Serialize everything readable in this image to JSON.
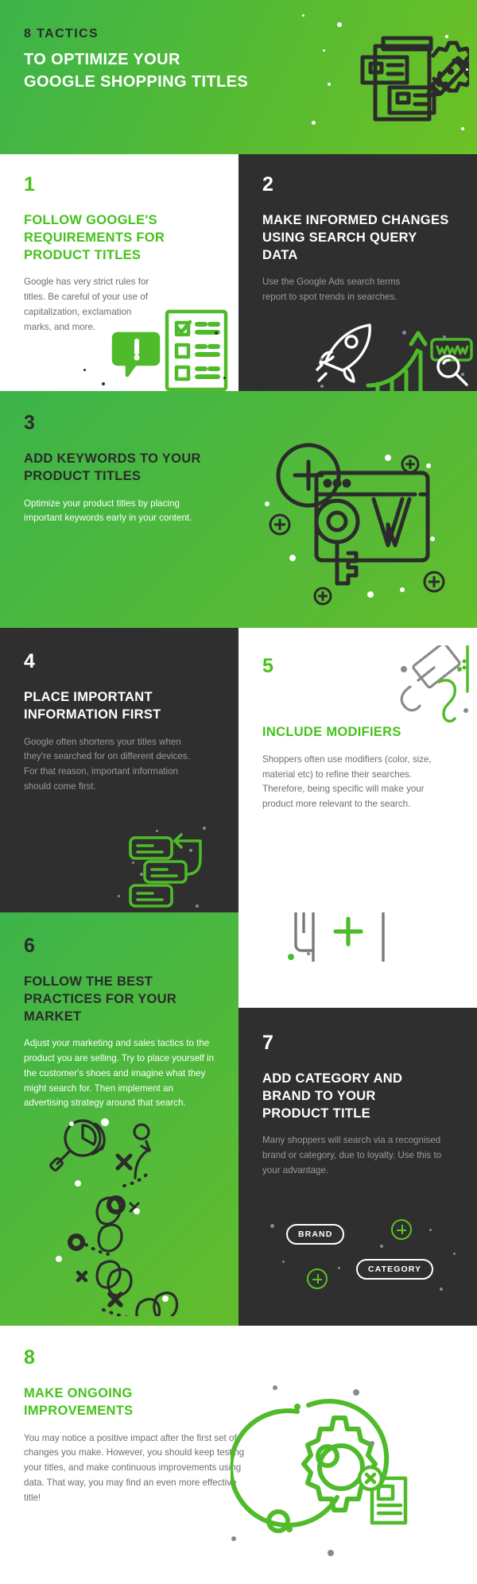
{
  "header": {
    "kicker": "8 TACTICS",
    "title_line1": "TO OPTIMIZE YOUR",
    "title_line2": "GOOGLE SHOPPING TITLES",
    "icon": "document-gear-pencil-icon"
  },
  "colors": {
    "green_bright": "#45c21c",
    "green_mid": "#57bb32",
    "green_dark": "#3cb44a",
    "dark": "#2f2f2f",
    "white": "#ffffff",
    "gray_text": "#6e6e6e",
    "muted_text": "#9a9a9a"
  },
  "sections": [
    {
      "number": "1",
      "heading": "FOLLOW GOOGLE'S REQUIREMENTS FOR PRODUCT TITLES",
      "body": "Google has very strict rules for titles. Be careful of your use of capitalization, exclamation marks, and more.",
      "theme": "white",
      "icon": "checklist-exclamation-icon"
    },
    {
      "number": "2",
      "heading": "MAKE INFORMED CHANGES USING SEARCH QUERY DATA",
      "body": "Use the Google Ads search terms report to spot trends in searches.",
      "theme": "dark",
      "icon": "rocket-growth-chart-www-search-icon"
    },
    {
      "number": "3",
      "heading": "ADD KEYWORDS TO YOUR PRODUCT TITLES",
      "body": "Optimize your product titles by placing important keywords early in your content.",
      "theme": "green",
      "icon": "browser-key-keyword-icon"
    },
    {
      "number": "4",
      "heading": "PLACE IMPORTANT INFORMATION FIRST",
      "body": "Google often shortens your titles when they're searched for on different devices. For that reason, important information should come first.",
      "theme": "dark",
      "icon": "reorder-list-arrow-icon"
    },
    {
      "number": "5",
      "heading": "INCLUDE MODIFIERS",
      "body": "Shoppers often use modifiers (color, size, material etc) to refine their searches. Therefore, being specific will make your product more relevant to the search.",
      "theme": "white",
      "icon": "paint-roller-icon",
      "icon2": "stacked-cards-plus-icon"
    },
    {
      "number": "6",
      "heading": "FOLLOW THE BEST PRACTICES FOR YOUR MARKET",
      "body": "Adjust your marketing and sales tactics to the product you are selling. Try to place yourself in the customer's shoes and imagine what they might search for. Then implement an advertising strategy around that search.",
      "theme": "green",
      "icon": "footprints-path-magnifier-icon"
    },
    {
      "number": "7",
      "heading": "ADD CATEGORY AND BRAND TO YOUR PRODUCT TITLE",
      "body": "Many shoppers will search via a recognised brand or category, due to loyalty. Use this to your advantage.",
      "theme": "dark",
      "icon": "tag-pills-icon",
      "pills": [
        "BRAND",
        "CATEGORY"
      ]
    },
    {
      "number": "8",
      "heading": "MAKE ONGOING IMPROVEMENTS",
      "body": "You may notice a positive impact after the first set of changes you make. However, you should keep testing your titles, and make continuous improvements using data. That way, you may find an even more effective title!",
      "theme": "white",
      "icon": "gear-orbit-documents-icon"
    }
  ]
}
